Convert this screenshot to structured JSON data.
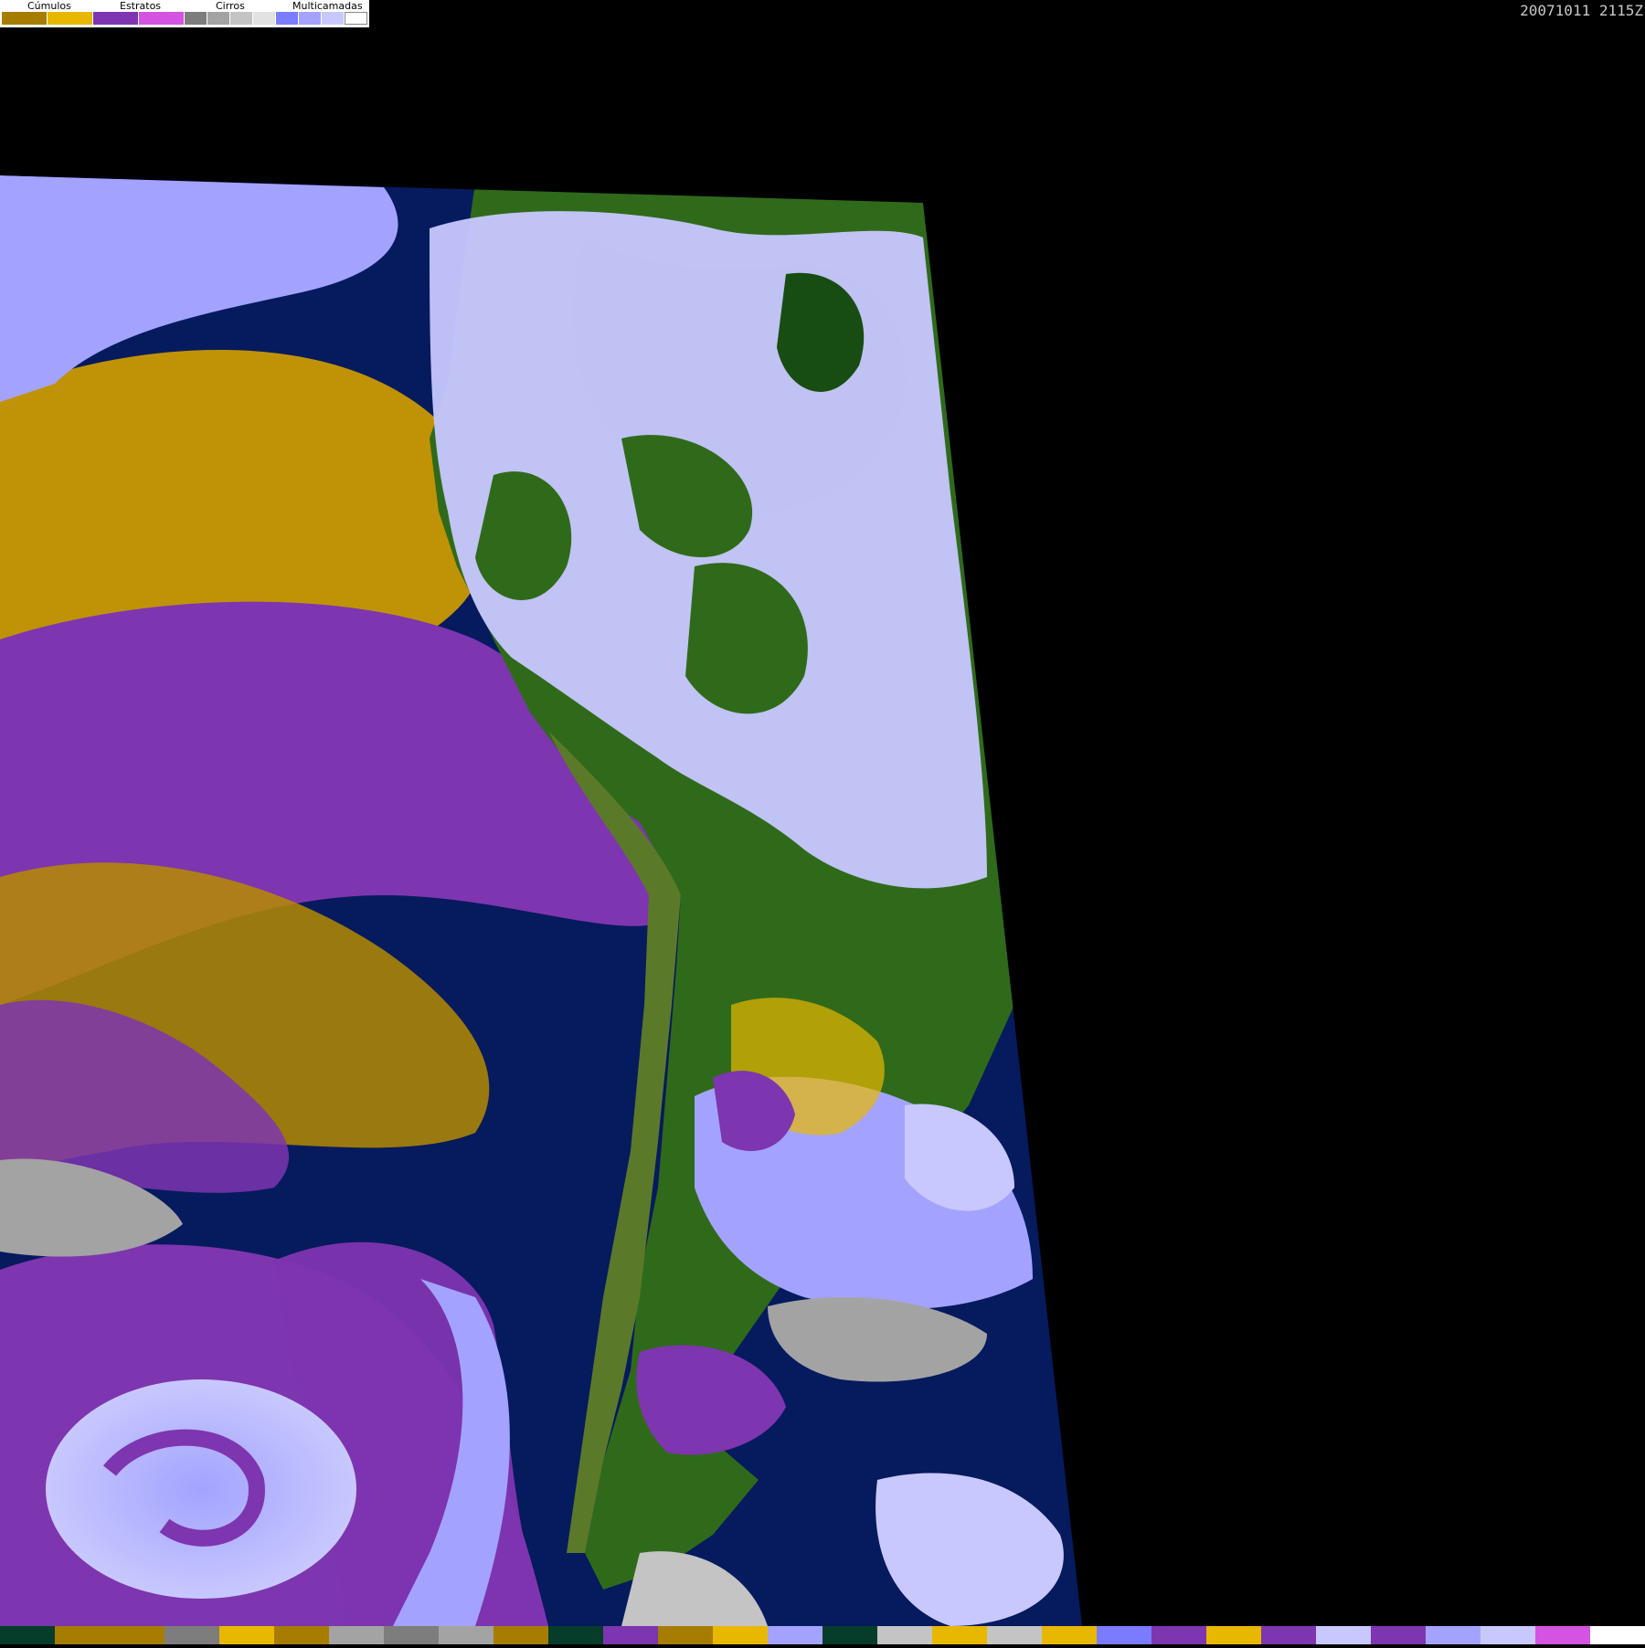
{
  "legend": {
    "groups": [
      {
        "label": "Cúmulos",
        "colors": [
          "#a77d00",
          "#e8b800"
        ]
      },
      {
        "label": "Estratos",
        "colors": [
          "#7e35b0",
          "#d453e0"
        ]
      },
      {
        "label": "Cirros",
        "colors": [
          "#7d7d7d",
          "#a3a3a3",
          "#c4c4c4",
          "#e2e2e2"
        ]
      },
      {
        "label": "Multicamadas",
        "colors": [
          "#7b7bff",
          "#a3a3ff",
          "#c8c8ff",
          "#ffffff"
        ]
      }
    ]
  },
  "timestamp": "20071011 2115Z",
  "colors": {
    "background": "#000000",
    "ocean": "#061a5e",
    "land": "#2f6a1a",
    "land_dark": "#174d12",
    "cumulus_low": "#a77d00",
    "cumulus_high": "#e8b800",
    "stratus_low": "#7e35b0",
    "stratus_high": "#d453e0",
    "cirrus_gray": "#a3a3a3",
    "multilayer_blue": "#a3a3ff",
    "multilayer_light": "#c8c8ff"
  },
  "bottom_strip": [
    "#063d2a",
    "#a77d00",
    "#a77d00",
    "#7d7d7d",
    "#e8b800",
    "#a77d00",
    "#a3a3a3",
    "#7d7d7d",
    "#a3a3a3",
    "#a77d00",
    "#063d2a",
    "#7e35b0",
    "#a77d00",
    "#e8b800",
    "#a3a3ff",
    "#063d2a",
    "#c4c4c4",
    "#e8b800",
    "#c4c4c4",
    "#e8b800",
    "#7b7bff",
    "#7e35b0",
    "#e8b800",
    "#7e35b0",
    "#c8c8ff",
    "#7e35b0",
    "#a3a3ff",
    "#c8c8ff",
    "#d453e0",
    "#ffffff"
  ]
}
